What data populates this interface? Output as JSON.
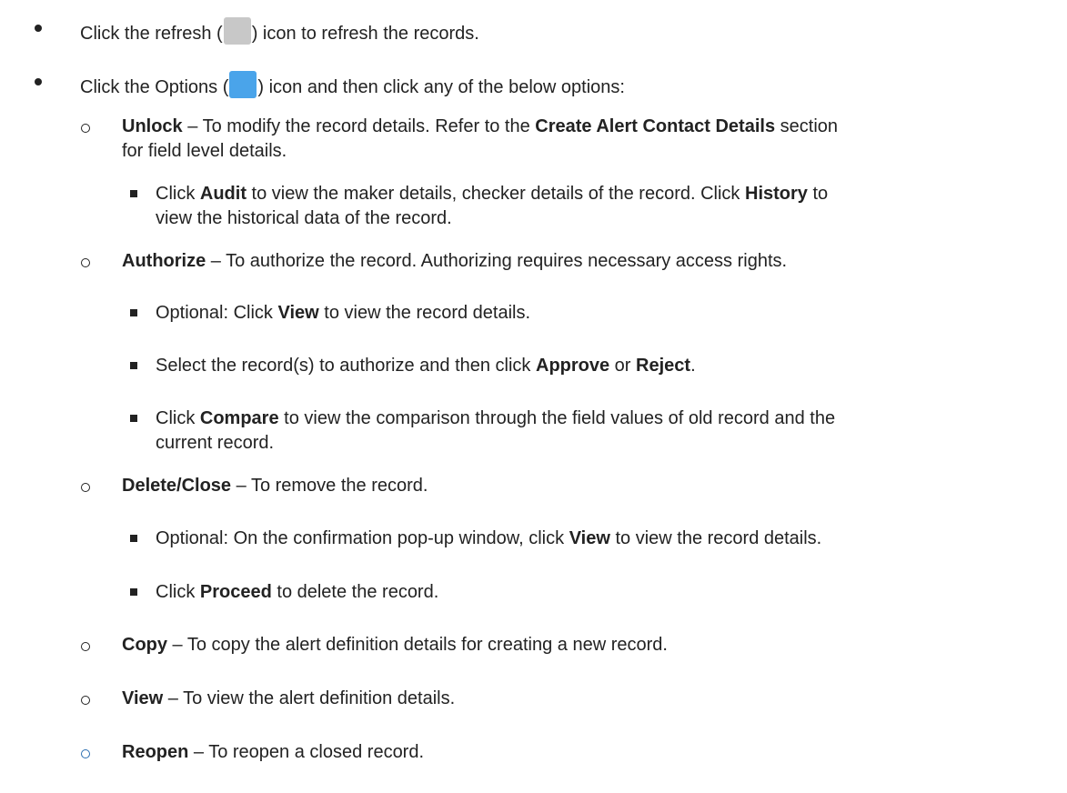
{
  "items": {
    "refresh": {
      "a": "Click the refresh (",
      "b": ") icon to refresh the records."
    },
    "options": {
      "a": "Click the Options (",
      "b": ") icon and then click any of the below options:"
    },
    "unlock": {
      "title": "Unlock",
      "a": " – To modify the record details. Refer to the ",
      "b": "Create Alert Contact Details",
      "c": " section",
      "d": "for field level details."
    },
    "audit": {
      "a": "Click ",
      "b": "Audit",
      "c": " to view the maker details, checker details of the record. Click ",
      "d": "History",
      "e": " to",
      "f": "view the historical data of the record."
    },
    "authorize": {
      "title": "Authorize",
      "a": " – To authorize the record. Authorizing requires necessary access rights."
    },
    "auth_view": {
      "a": "Optional: Click ",
      "b": "View",
      "c": " to view the record details."
    },
    "auth_select": {
      "a": "Select the record(s) to authorize and then click ",
      "b": "Approve",
      "c": " or ",
      "d": "Reject",
      "e": "."
    },
    "auth_compare": {
      "a": "Click ",
      "b": "Compare",
      "c": " to view the comparison through the field values of old record and the",
      "d": "current record."
    },
    "delete": {
      "title": "Delete/Close",
      "a": " – To remove the record."
    },
    "del_view": {
      "a": "Optional: On the confirmation pop-up window, click ",
      "b": "View",
      "c": " to view the record details."
    },
    "del_proceed": {
      "a": "Click ",
      "b": "Proceed",
      "c": " to delete the record."
    },
    "copy": {
      "title": "Copy",
      "a": " – To copy the alert definition details for creating a new record."
    },
    "view": {
      "title": "View",
      "a": " – To view the alert definition details."
    },
    "reopen": {
      "title": "Reopen",
      "a": " – To reopen a closed record."
    }
  },
  "icons": {
    "refresh": "refresh-icon",
    "options": "options-icon"
  },
  "colors": {
    "refresh_icon": "#c8c8c8",
    "options_icon": "#4aa4ea"
  }
}
